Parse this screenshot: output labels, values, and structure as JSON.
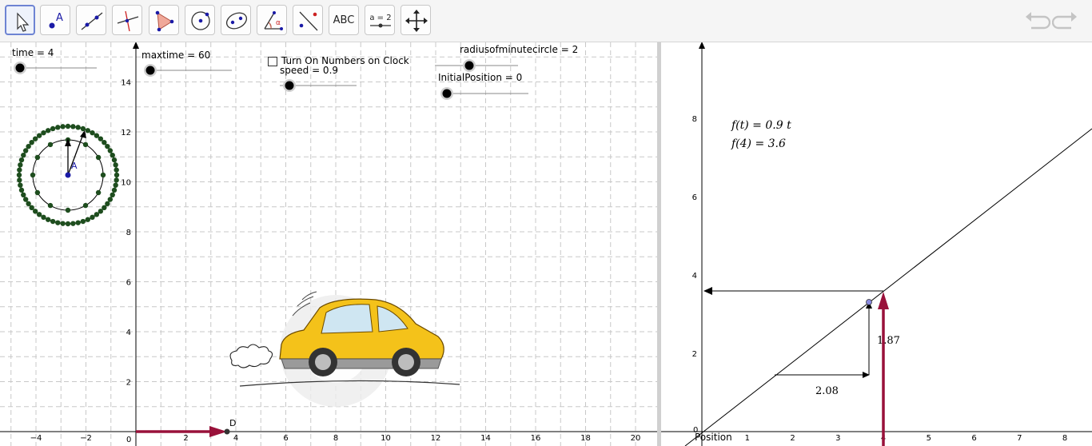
{
  "toolbar": {
    "tools": [
      {
        "name": "move-tool",
        "label": "",
        "selected": true
      },
      {
        "name": "point-tool",
        "label": "A"
      },
      {
        "name": "line-tool",
        "label": ""
      },
      {
        "name": "perpendicular-line-tool",
        "label": ""
      },
      {
        "name": "polygon-tool",
        "label": ""
      },
      {
        "name": "circle-center-point-tool",
        "label": ""
      },
      {
        "name": "ellipse-tool",
        "label": ""
      },
      {
        "name": "angle-tool",
        "label": "α"
      },
      {
        "name": "reflect-tool",
        "label": ""
      },
      {
        "name": "text-tool",
        "label": "ABC"
      },
      {
        "name": "slider-tool",
        "label": "a = 2"
      },
      {
        "name": "move-graphics-view-tool",
        "label": ""
      }
    ],
    "undo_icon": "undo-icon",
    "redo_icon": "redo-icon"
  },
  "graphics1": {
    "sliders": {
      "time": "time = 4",
      "maxtime": "maxtime = 60",
      "speed": "speed = 0.9",
      "radius": "radiusofminutecircle = 2",
      "initial_position": "InitialPosition = 0"
    },
    "checkbox_label": "Turn On Numbers on Clock",
    "point_A_label": "A",
    "point_D_label": "D",
    "x_ticks": [
      "−4",
      "−2",
      "2",
      "4",
      "6",
      "8",
      "10",
      "12",
      "14",
      "16",
      "18",
      "20"
    ],
    "y_ticks": [
      "2",
      "4",
      "6",
      "8",
      "10",
      "12",
      "14"
    ],
    "origin_label": "0",
    "car_image": "yellow-car-illustration"
  },
  "graphics2": {
    "formula_1": "f(t) = 0.9 t",
    "formula_2": "f(4) = 3.6",
    "x_ticks": [
      "1",
      "2",
      "3",
      "4",
      "5",
      "6",
      "7",
      "8"
    ],
    "y_ticks": [
      "2",
      "4",
      "6",
      "8"
    ],
    "origin_label": "0",
    "x_axis_label": "Position",
    "slope_run_label": "2.08",
    "slope_rise_label": "1.87"
  },
  "colors": {
    "accent_maroon": "#99113a",
    "clock_green": "#1e4d1e",
    "point_blue": "#1a1aa6",
    "car_yellow": "#f4c21a",
    "toolbar_selected": "#6e84d3"
  }
}
